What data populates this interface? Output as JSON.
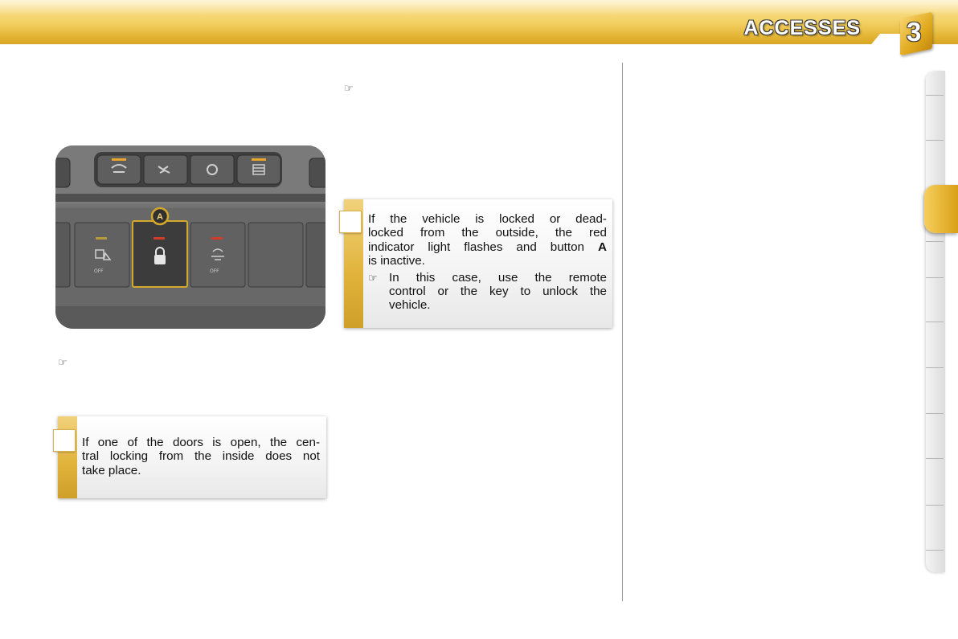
{
  "header": {
    "section_title": "ACCESSES",
    "chapter_number": "3"
  },
  "icons": {
    "pointer": "☞",
    "pointer_icon_name": "pointing-hand-icon"
  },
  "photo": {
    "button_label": "A",
    "off_label_left": "OFF",
    "off_label_right": "OFF"
  },
  "note_doors_open": {
    "line1": "If one of the doors is open, the cen-",
    "line2": "tral locking from the inside does not",
    "line3": "take place."
  },
  "note_locked_outside": {
    "line1": "If the vehicle is locked or dead-",
    "line2": "locked from the outside, the red",
    "line3_prefix": "indicator light flashes and button ",
    "line3_button": "A",
    "line4": "is inactive.",
    "bullet_line1": "In this case, use the remote",
    "bullet_line2": "control or the key to unlock the",
    "bullet_line3": "vehicle."
  },
  "colors": {
    "accent_gold": "#e0b239",
    "header_gold": "#f3d063",
    "indicator_red": "#d23a2a",
    "indicator_amber": "#e8a52c"
  }
}
